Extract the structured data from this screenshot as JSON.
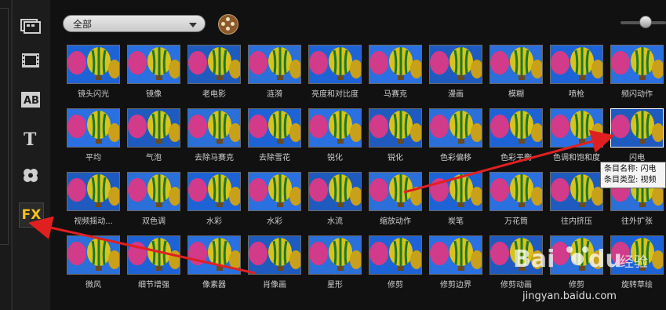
{
  "toolbar": {
    "category_dropdown_value": "全部"
  },
  "sidebar": {
    "fx_label": "FX",
    "items": [
      {
        "name": "media-library-icon"
      },
      {
        "name": "film-icon"
      },
      {
        "name": "transition-icon",
        "text": "AB"
      },
      {
        "name": "title-icon",
        "text": "T"
      },
      {
        "name": "graphic-flower-icon"
      },
      {
        "name": "fx-filter-icon",
        "text": "FX"
      }
    ]
  },
  "filters": [
    [
      "镜头闪光",
      "镜像",
      "老电影",
      "涟漪",
      "亮度和对比度",
      "马赛克",
      "漫画",
      "模糊",
      "喷枪",
      "频闪动作"
    ],
    [
      "平均",
      "气泡",
      "去除马赛克",
      "去除雪花",
      "锐化",
      "锐化",
      "色彩偏移",
      "色彩平衡",
      "色调和饱和度",
      "闪电"
    ],
    [
      "视频摇动...",
      "双色调",
      "水彩",
      "水彩",
      "水流",
      "缩放动作",
      "炭笔",
      "万花筒",
      "往内挤压",
      "往外扩张"
    ],
    [
      "微风",
      "细节增强",
      "像素器",
      "肖像画",
      "星形",
      "修剪",
      "修剪边界",
      "修剪动画",
      "修剪",
      "旋转草绘"
    ]
  ],
  "tooltip": {
    "line1": "条目名称: 闪电",
    "line2": "条目类型: 视频"
  },
  "watermark": {
    "logo_text": "Bai du 经验",
    "url": "jingyan.baidu.com"
  },
  "colors": {
    "accent_fx": "#f3c31b",
    "arrow": "#e02020",
    "background": "#111111"
  }
}
